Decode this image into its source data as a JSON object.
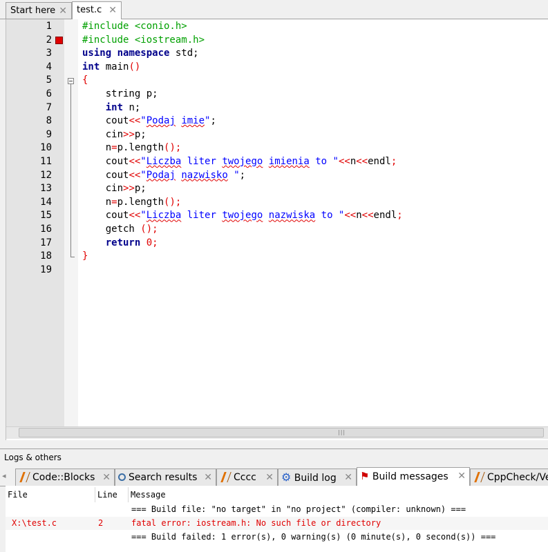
{
  "editor_tabs": [
    {
      "label": "Start here",
      "close": "✕"
    },
    {
      "label": "test.c",
      "close": "✕"
    }
  ],
  "line_numbers": [
    "1",
    "2",
    "3",
    "4",
    "5",
    "6",
    "7",
    "8",
    "9",
    "10",
    "11",
    "12",
    "13",
    "14",
    "15",
    "16",
    "17",
    "18",
    "19"
  ],
  "code": {
    "l1": "#include <conio.h>",
    "l2": "#include <iostream.h>",
    "l3_kw1": "using",
    "l3_kw2": "namespace",
    "l3_rest": " std;",
    "l4_kw": "int",
    "l4_name": " main",
    "l4_paren": "()",
    "l5": "{",
    "l6": "    string p;",
    "l7_kw": "int",
    "l7_rest": " n;",
    "l8_a": "    cout",
    "l8_op": "<<",
    "l8_q1": "\"",
    "l8_w1": "Podaj",
    "l8_sp": " ",
    "l8_w2": "imie",
    "l8_q2": "\"",
    "l8_end": ";",
    "l9_a": "    cin",
    "l9_op": ">>",
    "l9_end": "p;",
    "l10_a": "    n",
    "l10_op1": "=",
    "l10_b": "p.length",
    "l10_op2": "();",
    "l11_a": "    cout",
    "l11_op1": "<<",
    "l11_q": "\"",
    "l11_w1": "Liczba",
    "l11_s1": " liter ",
    "l11_w2": "twojego",
    "l11_s2": " ",
    "l11_w3": "imienia",
    "l11_s3": " to \"",
    "l11_op2": "<<",
    "l11_n": "n",
    "l11_op3": "<<",
    "l11_end": "endl",
    "l11_semi": ";",
    "l12_a": "    cout",
    "l12_op": "<<",
    "l12_q1": "\"",
    "l12_w1": "Podaj",
    "l12_sp": " ",
    "l12_w2": "nazwisko",
    "l12_q2": " \"",
    "l12_end": ";",
    "l13_a": "    cin",
    "l13_op": ">>",
    "l13_end": "p;",
    "l14_a": "    n",
    "l14_op1": "=",
    "l14_b": "p.length",
    "l14_op2": "();",
    "l15_a": "    cout",
    "l15_op1": "<<",
    "l15_q": "\"",
    "l15_w1": "Liczba",
    "l15_s1": " liter ",
    "l15_w2": "twojego",
    "l15_s2": " ",
    "l15_w3": "nazwiska",
    "l15_s3": " to \"",
    "l15_op2": "<<",
    "l15_n": "n",
    "l15_op3": "<<",
    "l15_end": "endl",
    "l15_semi": ";",
    "l16_a": "    getch ",
    "l16_op": "();",
    "l17_kw": "return",
    "l17_num": "0",
    "l17_semi": ";",
    "l18": "}"
  },
  "logs": {
    "title": "Logs & others",
    "tabs": [
      {
        "label": "Code::Blocks",
        "icon": "pencil-icon"
      },
      {
        "label": "Search results",
        "icon": "search-icon"
      },
      {
        "label": "Cccc",
        "icon": "pencil-icon"
      },
      {
        "label": "Build log",
        "icon": "gear-icon"
      },
      {
        "label": "Build messages",
        "icon": "flag-icon"
      },
      {
        "label": "CppCheck/Ve",
        "icon": "pencil-icon"
      }
    ],
    "close": "✕",
    "nav": "◂"
  },
  "messages": {
    "headers": {
      "file": "File",
      "line": "Line",
      "message": "Message"
    },
    "rows": [
      {
        "file": "",
        "line": "",
        "message": "=== Build file: \"no target\" in \"no project\" (compiler: unknown) ==="
      },
      {
        "file": "X:\\test.c",
        "line": "2",
        "message": "fatal error: iostream.h: No such file or directory"
      },
      {
        "file": "",
        "line": "",
        "message": "=== Build failed: 1 error(s), 0 warning(s) (0 minute(s), 0 second(s)) ==="
      }
    ]
  }
}
